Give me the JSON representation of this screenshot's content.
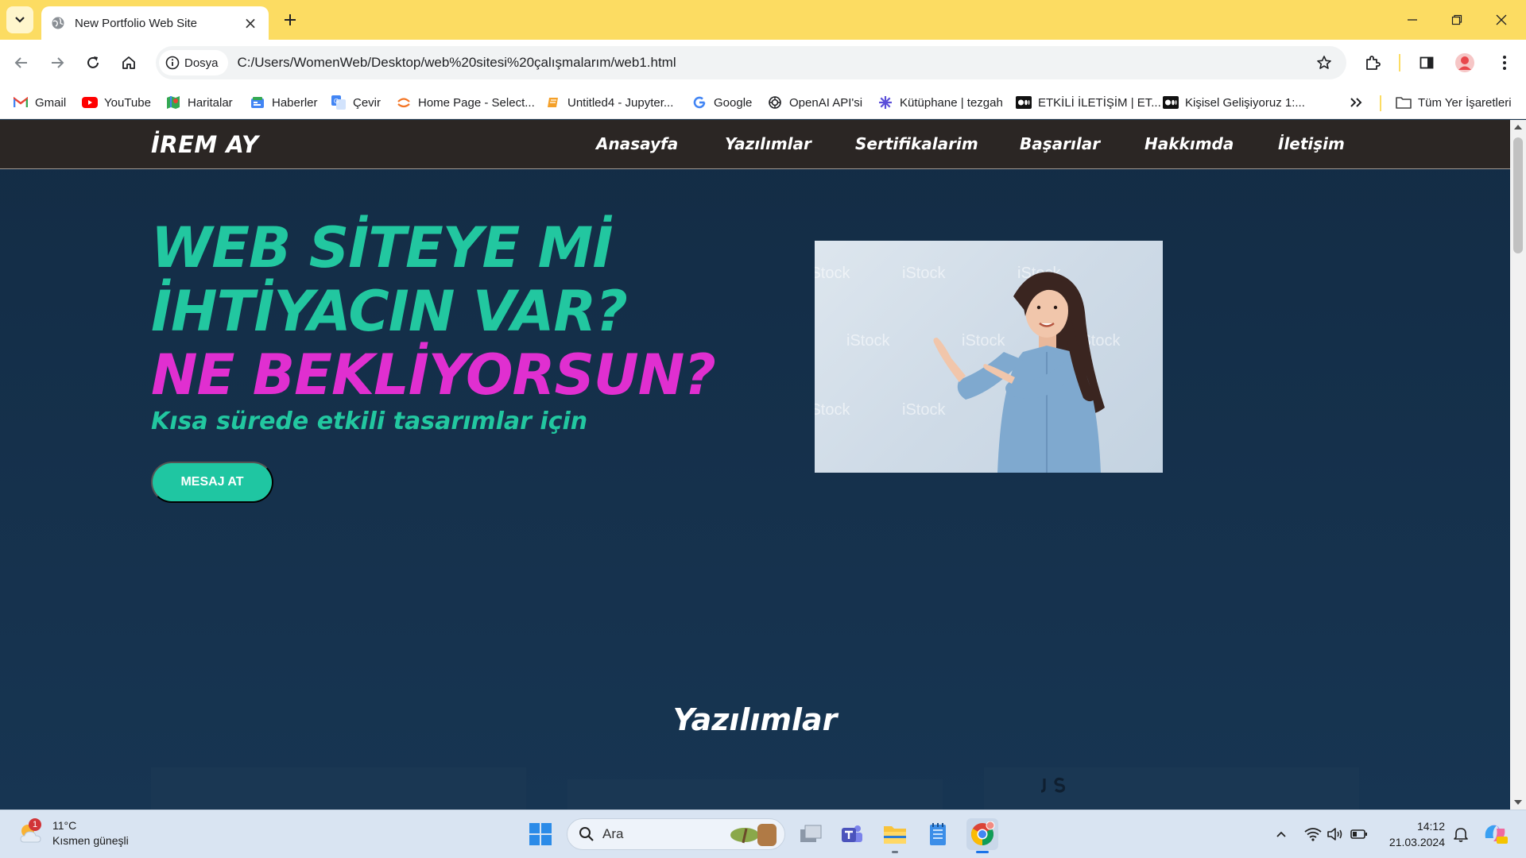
{
  "browser": {
    "tab_title": "New Portfolio Web Site",
    "security_chip": "Dosya",
    "url": "C:/Users/WomenWeb/Desktop/web%20sitesi%20çalışmalarım/web1.html",
    "bookmarks": [
      {
        "label": "Gmail",
        "icon": "gmail-icon"
      },
      {
        "label": "YouTube",
        "icon": "youtube-icon"
      },
      {
        "label": "Haritalar",
        "icon": "maps-icon"
      },
      {
        "label": "Haberler",
        "icon": "news-icon"
      },
      {
        "label": "Çevir",
        "icon": "translate-icon"
      },
      {
        "label": "Home Page - Select...",
        "icon": "jupyter-icon"
      },
      {
        "label": "Untitled4 - Jupyter...",
        "icon": "notebook-icon"
      },
      {
        "label": "Google",
        "icon": "google-icon"
      },
      {
        "label": "OpenAI API'si",
        "icon": "openai-icon"
      },
      {
        "label": "Kütüphane | tezgah",
        "icon": "tezgah-icon"
      },
      {
        "label": "ETKİLİ İLETİŞİM | ET...",
        "icon": "medium-icon"
      },
      {
        "label": "Kişisel Gelişiyoruz 1:...",
        "icon": "medium-icon"
      }
    ],
    "all_bookmarks": "Tüm Yer İşaretleri"
  },
  "site": {
    "logo": "İREM AY",
    "nav": [
      "Anasayfa",
      "Yazılımlar",
      "Sertifikalarim",
      "Başarılar",
      "Hakkımda",
      "İletişim"
    ],
    "hero": {
      "line1": "WEB SİTEYE Mİ",
      "line2": "İHTİYACIN VAR?",
      "line3": "NE BEKLİYORSUN?",
      "subtitle": "Kısa sürede etkili tasarımlar için",
      "cta": "MESAJ AT",
      "image_watermark": "iStock"
    },
    "section_title": "Yazılımlar"
  },
  "colors": {
    "teal": "#22c7a0",
    "magenta": "#e02fd0",
    "navbar": "#2b2624",
    "page_bg": "#15304a",
    "chrome_yellow": "#fcdc62"
  },
  "taskbar": {
    "weather_temp": "11°C",
    "weather_desc": "Kısmen güneşli",
    "weather_badge": "1",
    "search_label": "Ara",
    "time": "14:12",
    "date": "21.03.2024"
  }
}
